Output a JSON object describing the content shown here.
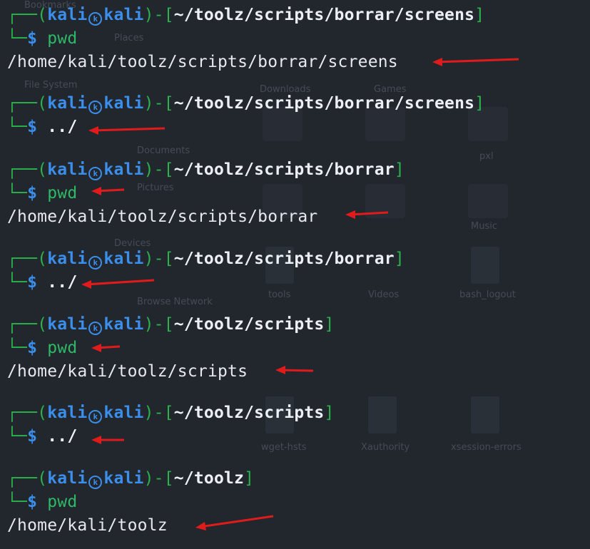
{
  "background_window": {
    "sidebar": [
      "Bookmarks",
      "Places",
      "File System",
      "Documents",
      "Pictures",
      "Devices",
      "Browse Network"
    ],
    "files": [
      "Downloads",
      "Games",
      "pxl",
      "Music",
      "tools",
      "Videos",
      "bash_logout",
      "Xauthority",
      "xsession-errors",
      "wget-hsts"
    ]
  },
  "prompt": {
    "user": "kali",
    "host": "kali",
    "dollar": "$"
  },
  "blocks": [
    {
      "path": "~/toolz/scripts/borrar/screens",
      "command": "pwd",
      "output": "/home/kali/toolz/scripts/borrar/screens"
    },
    {
      "path": "~/toolz/scripts/borrar/screens",
      "command": "../",
      "output": ""
    },
    {
      "path": "~/toolz/scripts/borrar",
      "command": "pwd",
      "output": "/home/kali/toolz/scripts/borrar"
    },
    {
      "path": "~/toolz/scripts/borrar",
      "command": "../",
      "output": ""
    },
    {
      "path": "~/toolz/scripts",
      "command": "pwd",
      "output": "/home/kali/toolz/scripts"
    },
    {
      "path": "~/toolz/scripts",
      "command": "../",
      "output": ""
    },
    {
      "path": "~/toolz",
      "command": "pwd",
      "output": "/home/kali/toolz"
    }
  ],
  "colors": {
    "prompt_frame": "#2bb24c",
    "user_host": "#3b8eea",
    "path": "#ecf0f5",
    "annotation_arrow": "#e01b1b",
    "background": "#22262d"
  }
}
